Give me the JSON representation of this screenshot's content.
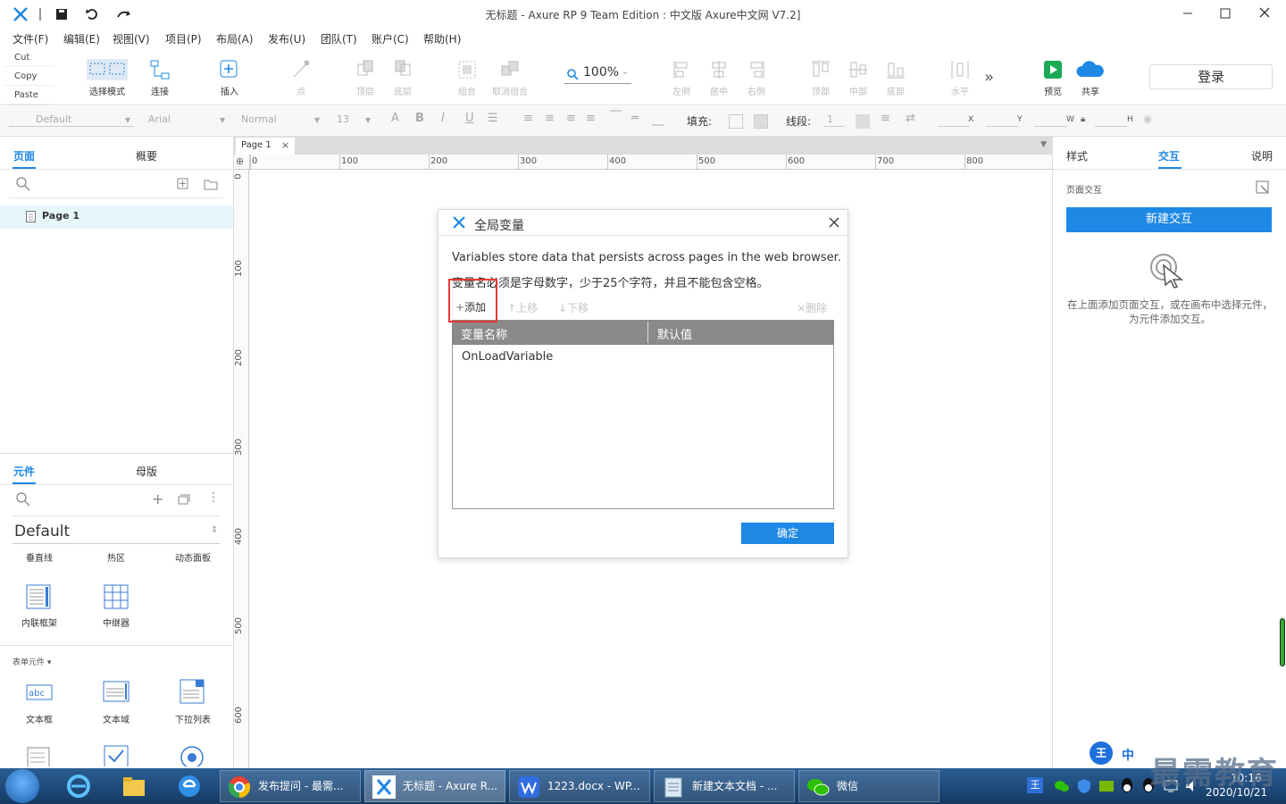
{
  "titlebar": {
    "title": "无标题 - Axure RP 9 Team Edition : 中文版   Axure中文网 V7.2]"
  },
  "menu": [
    "文件(F)",
    "编辑(E)",
    "视图(V)",
    "项目(P)",
    "布局(A)",
    "发布(U)",
    "团队(T)",
    "账户(C)",
    "帮助(H)"
  ],
  "clipboard": {
    "cut": "Cut",
    "copy": "Copy",
    "paste": "Paste"
  },
  "toolbar": {
    "select_mode": "选择模式",
    "connect": "连接",
    "insert": "插入",
    "point": "点",
    "top_layer": "顶层",
    "bottom_layer": "底层",
    "group": "组合",
    "ungroup": "取消组合",
    "zoom": "100%",
    "left": "左侧",
    "center": "居中",
    "right": "右侧",
    "top": "顶部",
    "middle": "中部",
    "bottom": "底部",
    "horizontal": "水平",
    "preview": "预览",
    "share": "共享",
    "login": "登录"
  },
  "format": {
    "style": "Default",
    "font": "Arial",
    "weight": "Normal",
    "size": "13",
    "fill": "填充:",
    "line": "线段:",
    "line_value": "1",
    "x": "X",
    "y": "Y",
    "w": "W",
    "h": "H"
  },
  "left_panel": {
    "tabs": {
      "pages": "页面",
      "outline": "概要"
    },
    "page_item": "Page 1",
    "lib_tabs": {
      "widgets": "元件",
      "masters": "母版"
    },
    "library": "Default",
    "widgets_row1": [
      "垂直线",
      "热区",
      "动态面板"
    ],
    "widgets_row2": [
      "内联框架",
      "中继器"
    ],
    "form_section": "表单元件 ▾",
    "widgets_row3": [
      "文本框",
      "文本域",
      "下拉列表"
    ]
  },
  "canvas": {
    "page_tab": "Page 1",
    "hruler": [
      "0",
      "100",
      "200",
      "300",
      "400",
      "500",
      "600",
      "700",
      "800"
    ],
    "vruler": [
      "0",
      "100",
      "200",
      "300",
      "400",
      "500",
      "600"
    ]
  },
  "right_panel": {
    "tabs": {
      "style": "样式",
      "interaction": "交互",
      "notes": "说明"
    },
    "section": "页面交互",
    "new_interaction": "新建交互",
    "hint": "在上面添加页面交互，或在画布中选择元件，为元件添加交互。"
  },
  "dialog": {
    "title": "全局变量",
    "desc1": "Variables store data that persists across pages in the web browser.",
    "desc2": "变量名必须是字母数字，少于25个字符，并且不能包含空格。",
    "add": "添加",
    "move_up": "上移",
    "move_down": "下移",
    "delete": "删除",
    "col_name": "变量名称",
    "col_default": "默认值",
    "rows": [
      "OnLoadVariable"
    ],
    "ok": "确定"
  },
  "taskbar": {
    "tasks": [
      "发布提问 - 最需...",
      "无标题 - Axure R...",
      "1223.docx - WP...",
      "新建文本文档 - ...",
      "微信"
    ],
    "ime": "中",
    "time": "10:16",
    "date": "2020/10/21"
  },
  "watermark": "最需教育",
  "colors": {
    "accent": "#1e88e5",
    "highlight": "#e53935",
    "taskbar": "#1c4a78"
  }
}
